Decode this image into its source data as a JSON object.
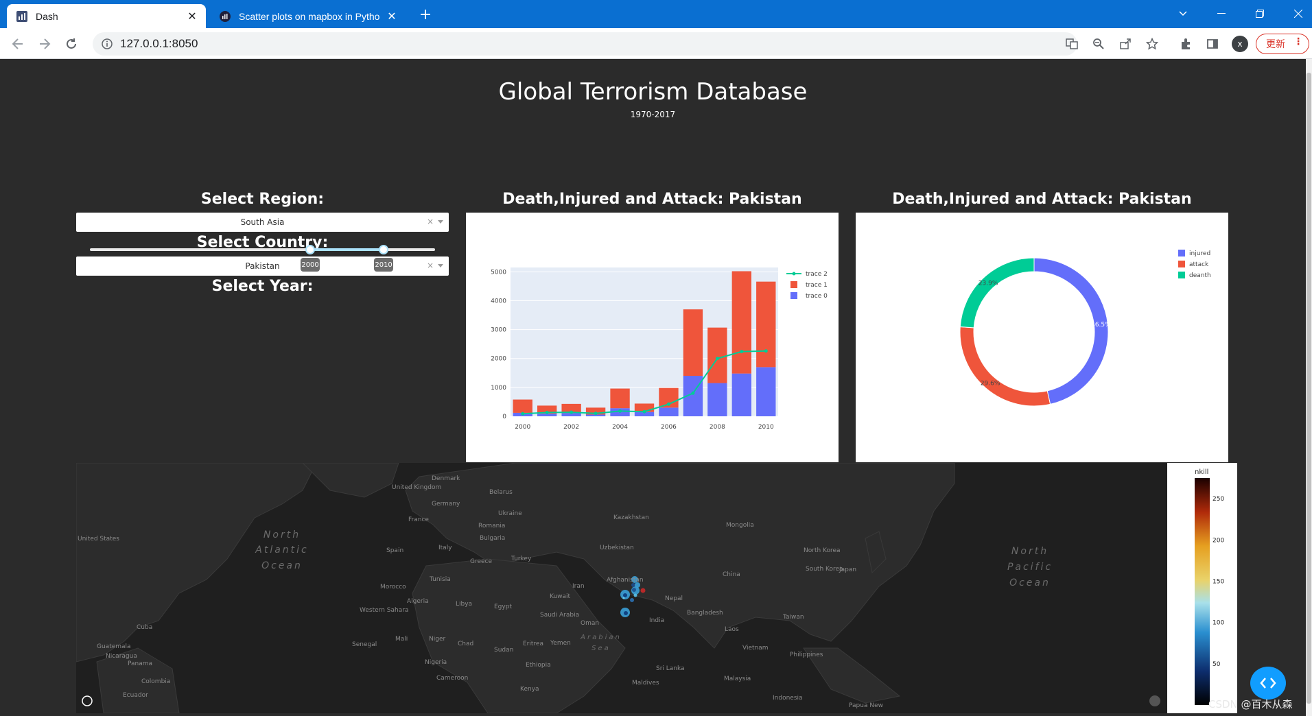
{
  "browser": {
    "tabs": [
      {
        "title": "Dash",
        "active": true
      },
      {
        "title": "Scatter plots on mapbox in Pytho",
        "active": false
      }
    ],
    "url": "127.0.0.1:8050",
    "update_label": "更新",
    "profile_initial": "x"
  },
  "page": {
    "title": "Global Terrorism Database",
    "subtitle": "1970-2017",
    "controls": {
      "region_label": "Select Region:",
      "region_value": "South Asia",
      "country_label": "Select Country:",
      "country_value": "Pakistan",
      "year_label": "Select Year:",
      "year_range": [
        2000,
        2010
      ],
      "year_min": 1970,
      "year_max": 2017
    },
    "bar_panel_title": "Death,Injured and Attack: Pakistan",
    "pie_panel_title": "Death,Injured and Attack: Pakistan"
  },
  "chart_data": [
    {
      "type": "bar",
      "barmode": "stack",
      "x": [
        2000,
        2001,
        2002,
        2003,
        2004,
        2005,
        2006,
        2007,
        2008,
        2009,
        2010
      ],
      "series": [
        {
          "name": "trace 0",
          "type": "bar",
          "color": "#636efa",
          "values": [
            120,
            90,
            110,
            60,
            280,
            150,
            300,
            1400,
            1150,
            1480,
            1700
          ]
        },
        {
          "name": "trace 1",
          "type": "bar",
          "color": "#ef553b",
          "values": [
            460,
            280,
            320,
            240,
            680,
            290,
            680,
            2300,
            1920,
            3540,
            2960
          ]
        },
        {
          "name": "trace 2",
          "type": "line",
          "color": "#00cc96",
          "values": [
            90,
            130,
            140,
            100,
            180,
            160,
            420,
            800,
            2000,
            2240,
            2260
          ]
        }
      ],
      "ylim": [
        0,
        5000
      ],
      "yticks": [
        0,
        1000,
        2000,
        3000,
        4000,
        5000
      ],
      "xticks": [
        2000,
        2002,
        2004,
        2006,
        2008,
        2010
      ],
      "legend_position": "top-right"
    },
    {
      "type": "pie",
      "hole": true,
      "labels": [
        "injured",
        "attack",
        "deanth"
      ],
      "values": [
        46.5,
        29.6,
        23.9
      ],
      "value_labels": [
        "46.5%",
        "29.6%",
        "23.9%"
      ],
      "colors": [
        "#636efa",
        "#ef553b",
        "#00cc96"
      ],
      "legend_position": "top-right"
    }
  ],
  "map": {
    "labels": [
      {
        "text": "United Kingdom"
      },
      {
        "text": "Denmark"
      },
      {
        "text": "Belarus"
      },
      {
        "text": "Germany"
      },
      {
        "text": "Ukraine"
      },
      {
        "text": "France"
      },
      {
        "text": "Romania"
      },
      {
        "text": "Kazakhstan"
      },
      {
        "text": "Mongolia"
      },
      {
        "text": "Spain"
      },
      {
        "text": "Italy"
      },
      {
        "text": "Bulgaria"
      },
      {
        "text": "Uzbekistan"
      },
      {
        "text": "Turkey"
      },
      {
        "text": "Greece"
      },
      {
        "text": "North Korea"
      },
      {
        "text": "South Korea"
      },
      {
        "text": "Japan"
      },
      {
        "text": "China"
      },
      {
        "text": "Afghanistan"
      },
      {
        "text": "Iran"
      },
      {
        "text": "Tunisia"
      },
      {
        "text": "Morocco"
      },
      {
        "text": "Algeria"
      },
      {
        "text": "Libya"
      },
      {
        "text": "Egypt"
      },
      {
        "text": "Kuwait"
      },
      {
        "text": "Nepal"
      },
      {
        "text": "Saudi Arabia"
      },
      {
        "text": "Oman"
      },
      {
        "text": "India"
      },
      {
        "text": "Bangladesh"
      },
      {
        "text": "Taiwan"
      },
      {
        "text": "Laos"
      },
      {
        "text": "Mali"
      },
      {
        "text": "Niger"
      },
      {
        "text": "Chad"
      },
      {
        "text": "Sudan"
      },
      {
        "text": "Eritrea"
      },
      {
        "text": "Yemen"
      },
      {
        "text": "Vietnam"
      },
      {
        "text": "Philippines"
      },
      {
        "text": "Senegal"
      },
      {
        "text": "Nigeria"
      },
      {
        "text": "Ethiopia"
      },
      {
        "text": "Sri Lanka"
      },
      {
        "text": "Cameroon"
      },
      {
        "text": "Maldives"
      },
      {
        "text": "Malaysia"
      },
      {
        "text": "Kenya"
      },
      {
        "text": "Indonesia"
      },
      {
        "text": "Colombia"
      },
      {
        "text": "Ecuador"
      },
      {
        "text": "Cuba"
      },
      {
        "text": "Guatemala"
      },
      {
        "text": "Nicaragua"
      },
      {
        "text": "Panama"
      },
      {
        "text": "United States"
      },
      {
        "text": "Papua New"
      },
      {
        "text": "Western Sahara"
      }
    ],
    "ocean_labels": [
      "North Atlantic Ocean",
      "North Pacific Ocean",
      "Arabian Sea"
    ],
    "colorbar": {
      "title": "nkill",
      "ticks": [
        50,
        100,
        150,
        200,
        250
      ]
    }
  },
  "watermark": "CSDN @百木从森"
}
